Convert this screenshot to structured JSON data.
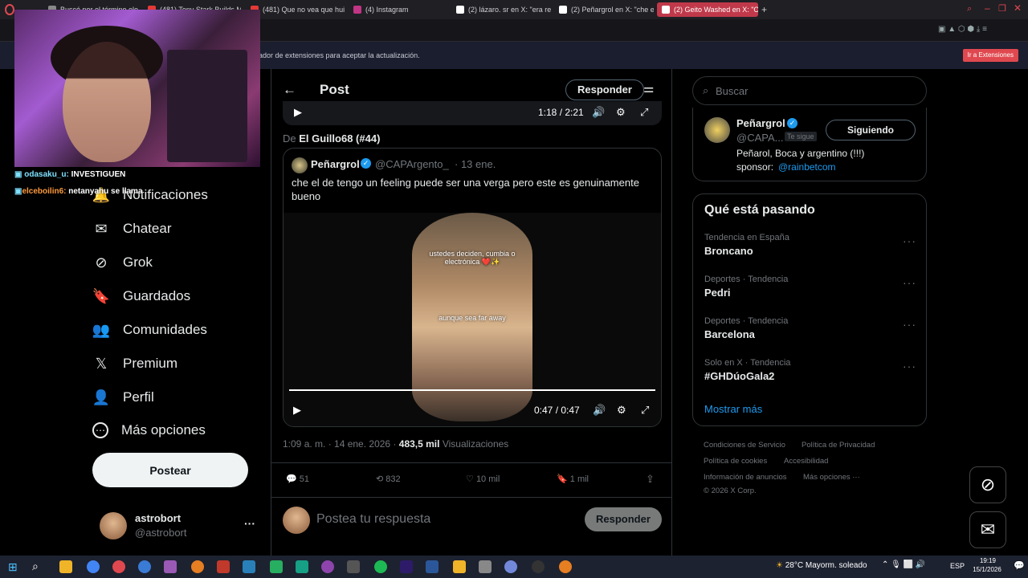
{
  "browser": {
    "tabs": [
      {
        "title": "Buscó por el término eloq",
        "color": "#888"
      },
      {
        "title": "(481) Tony Stark Builds M",
        "color": "#e53935"
      },
      {
        "title": "(481) Que no vea que hui d",
        "color": "#e53935"
      },
      {
        "title": "(4) Instagram",
        "color": "#c13584"
      },
      {
        "title": "(2) lázaro. sr en X: \"era re",
        "color": "#fff"
      },
      {
        "title": "(2) Peñargrol en X: \"che el",
        "color": "#fff"
      },
      {
        "title": "(2) Geito Washed en X: \"O",
        "color": "#fff",
        "active": true
      }
    ],
    "extension_notice": "ador de extensiones para aceptar la actualización.",
    "extension_button": "Ir a Extensiones"
  },
  "stream": {
    "chat": [
      {
        "user": "odasaku_u:",
        "message": "INVESTIGUEN",
        "color": "#7fe0ff"
      },
      {
        "user": "elceboilin6:",
        "message": "netanyahu se llama",
        "color": "#ff9a3c"
      }
    ]
  },
  "sidebar": {
    "items": [
      {
        "label": "Notificaciones",
        "icon": "bell-icon",
        "glyph": "🔔"
      },
      {
        "label": "Chatear",
        "icon": "mail-icon",
        "glyph": "✉"
      },
      {
        "label": "Grok",
        "icon": "grok-icon",
        "glyph": "⊘"
      },
      {
        "label": "Guardados",
        "icon": "bookmark-icon",
        "glyph": "🔖"
      },
      {
        "label": "Comunidades",
        "icon": "communities-icon",
        "glyph": "👥"
      },
      {
        "label": "Premium",
        "icon": "x-logo-icon",
        "glyph": "𝕏"
      },
      {
        "label": "Perfil",
        "icon": "profile-icon",
        "glyph": "👤"
      },
      {
        "label": "Más opciones",
        "icon": "more-icon",
        "glyph": "⋯"
      }
    ],
    "post_button": "Postear",
    "account": {
      "name": "astrobort",
      "handle": "@astrobort"
    }
  },
  "main": {
    "header_title": "Post",
    "reply_button": "Responder",
    "top_video_time": "1:18 / 2:21",
    "from_prefix": "De",
    "from_name": "El Guillo68 (#44)",
    "quote": {
      "author": "Peñargrol",
      "handle": "@CAPArgento_",
      "date": "· 13 ene.",
      "text": "che el de tengo un feeling puede ser una verga pero este es genuinamente bueno",
      "video": {
        "caption1": "ustedes deciden, cumbia o electrónica ❤️✨",
        "caption2": "aunque sea far away",
        "time": "0:47 / 0:47",
        "progress": 1.0
      }
    },
    "meta": {
      "time": "1:09 a. m. · 14 ene. 2026 ·",
      "views": "483,5 mil",
      "views_label": "Visualizaciones"
    },
    "actions": {
      "replies": "51",
      "reposts": "832",
      "likes": "10 mil",
      "bookmarks": "1 mil"
    },
    "reply_placeholder": "Postea tu respuesta",
    "reply_submit": "Responder"
  },
  "right": {
    "search_placeholder": "Buscar",
    "profile": {
      "name": "Peñargrol",
      "handle": "@CAPA...",
      "follows_you": "Te sigue",
      "following_button": "Siguiendo",
      "bio": "Peñarol, Boca y argentino (!!!)",
      "sponsor_label": "sponsor:",
      "sponsor_link": "@rainbetcom"
    },
    "trends_title": "Qué está pasando",
    "trends": [
      {
        "meta": "Tendencia en España",
        "name": "Broncano"
      },
      {
        "meta": "Deportes · Tendencia",
        "name": "Pedri"
      },
      {
        "meta": "Deportes · Tendencia",
        "name": "Barcelona"
      },
      {
        "meta": "Solo en X · Tendencia",
        "name": "#GHDúoGala2"
      }
    ],
    "show_more": "Mostrar más",
    "footer": [
      "Condiciones de Servicio",
      "Política de Privacidad",
      "Política de cookies",
      "Accesibilidad",
      "Información de anuncios",
      "Más opciones ···",
      "© 2026 X Corp."
    ]
  },
  "taskbar": {
    "weather": "28°C  Mayorm. soleado",
    "lang": "ESP",
    "time": "19:19",
    "date": "15/1/2026"
  },
  "colors": {
    "accent": "#1d9bf0",
    "border": "#2f3336",
    "muted": "#71767b"
  }
}
